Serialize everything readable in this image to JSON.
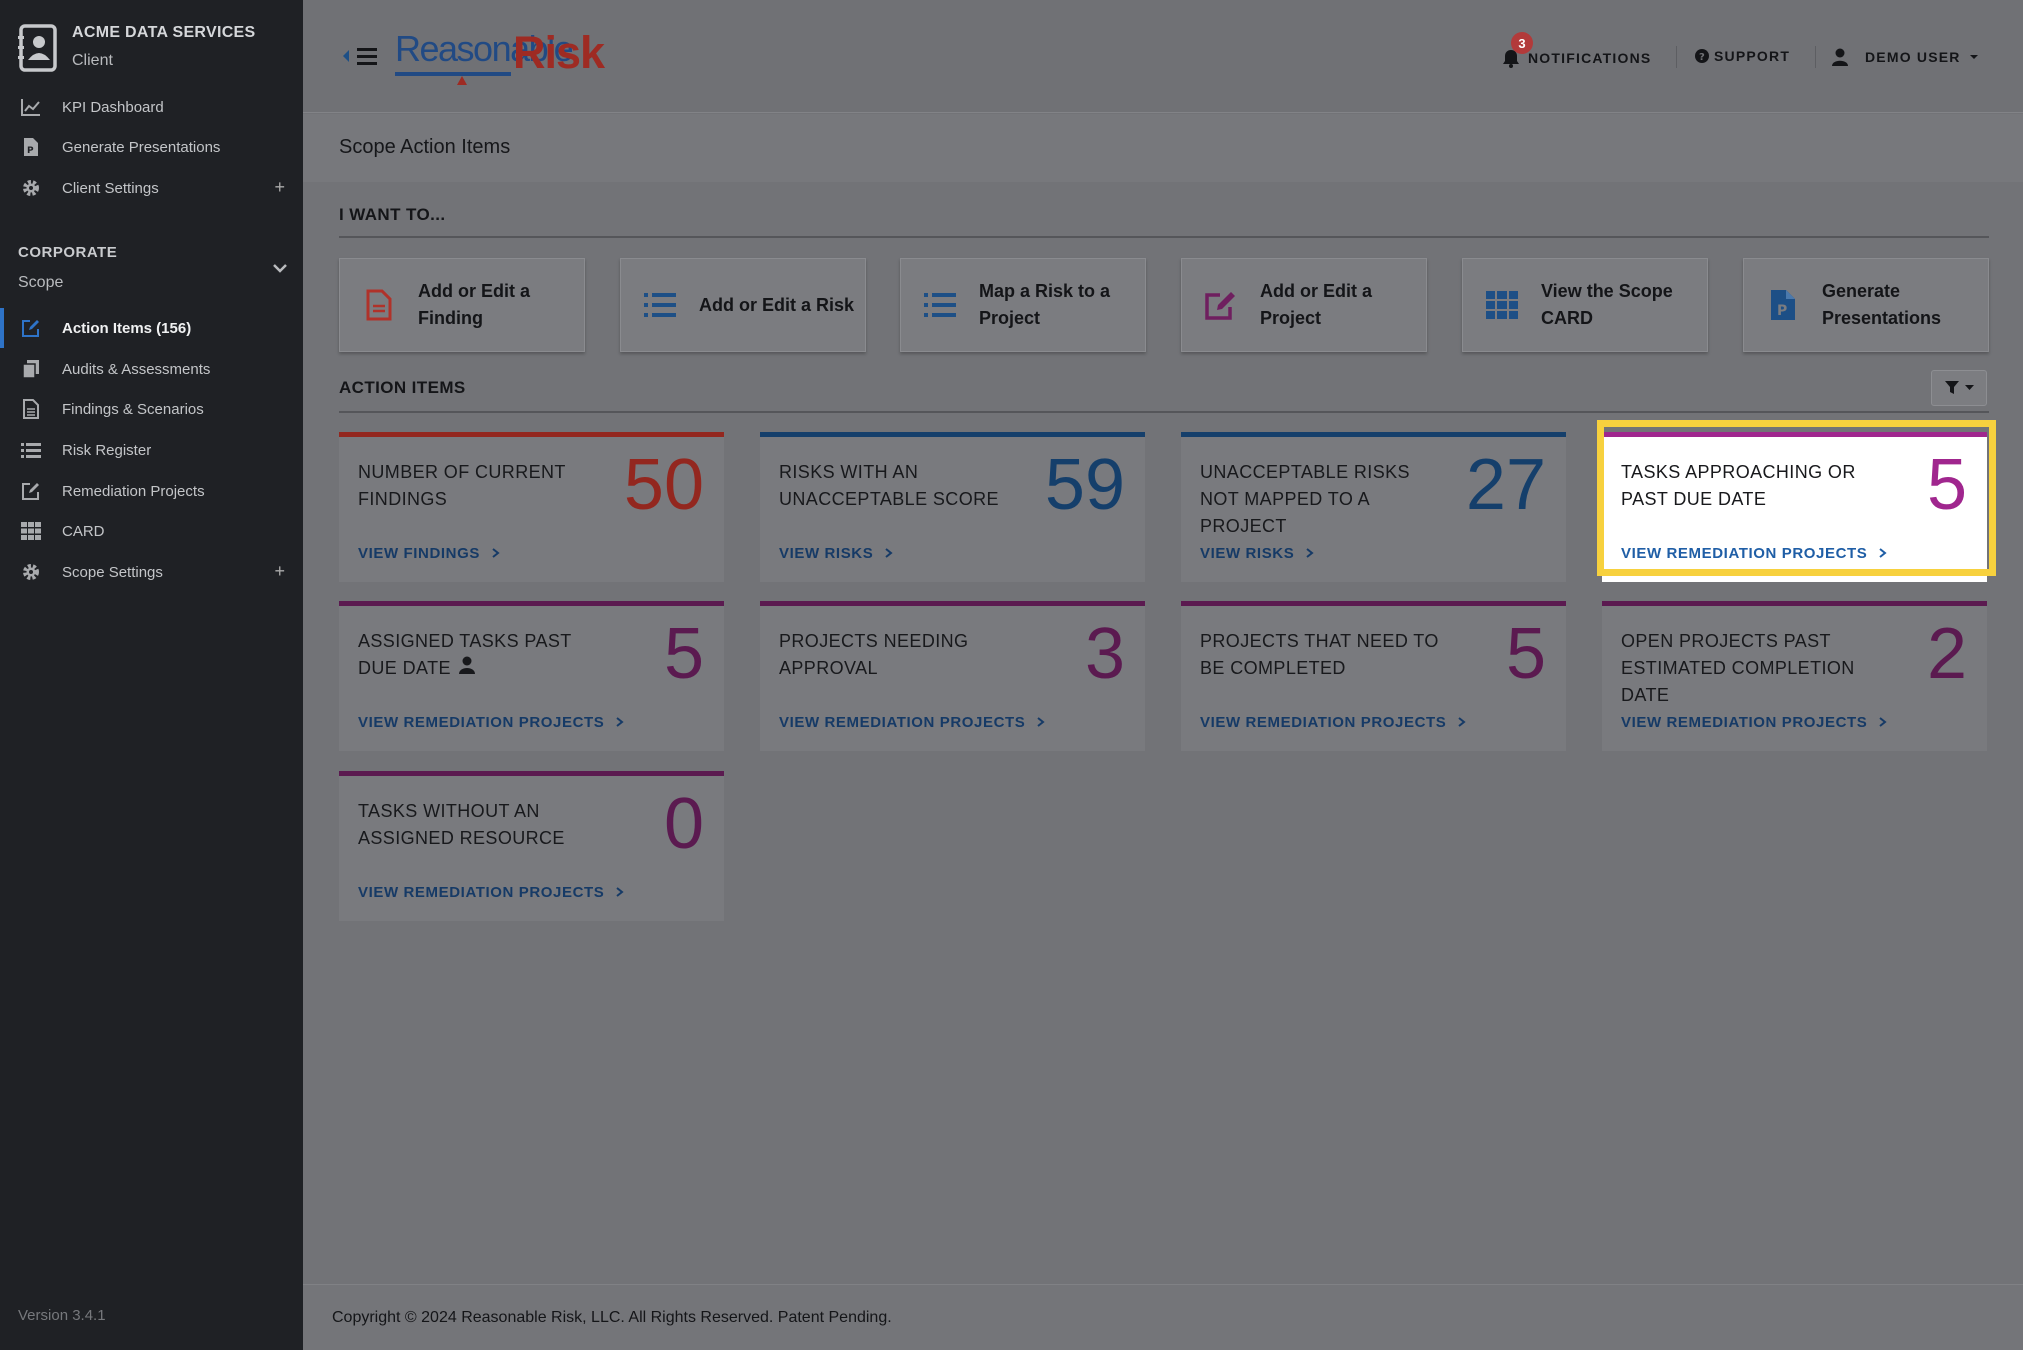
{
  "sidebar": {
    "client_name": "ACME DATA SERVICES",
    "client_type": "Client",
    "top_items": [
      {
        "label": "KPI Dashboard",
        "icon": "chart-line-icon"
      },
      {
        "label": "Generate Presentations",
        "icon": "presentation-file-icon"
      },
      {
        "label": "Client Settings",
        "icon": "gear-icon",
        "expand": "+"
      }
    ],
    "corporate_title": "CORPORATE",
    "corporate_sub": "Scope",
    "scope_items": [
      {
        "label": "Action Items (156)",
        "icon": "edit-square-icon",
        "active": true
      },
      {
        "label": "Audits & Assessments",
        "icon": "copy-docs-icon"
      },
      {
        "label": "Findings & Scenarios",
        "icon": "file-text-icon"
      },
      {
        "label": "Risk Register",
        "icon": "list-icon"
      },
      {
        "label": "Remediation Projects",
        "icon": "edit-square-icon"
      },
      {
        "label": "CARD",
        "icon": "grid-icon"
      },
      {
        "label": "Scope Settings",
        "icon": "gear-icon",
        "expand": "+"
      }
    ],
    "version": "Version 3.4.1"
  },
  "header": {
    "logo_part1": "Reasonable",
    "logo_part2": "Risk",
    "notification_count": "3",
    "notifications_label": "NOTIFICATIONS",
    "support_label": "SUPPORT",
    "user_label": "DEMO USER"
  },
  "page": {
    "title": "Scope Action Items",
    "i_want_to": "I WANT TO...",
    "action_items_title": "ACTION ITEMS"
  },
  "quick_actions": [
    {
      "line1": "Add or Edit a",
      "line2": "Finding",
      "icon": "file-text-icon",
      "color": "#b0322a"
    },
    {
      "line1": "Add or Edit a Risk",
      "line2": "",
      "icon": "list-icon",
      "color": "#1d4f86"
    },
    {
      "line1": "Map a Risk to a",
      "line2": "Project",
      "icon": "list-icon",
      "color": "#1d4f86"
    },
    {
      "line1": "Add or Edit a",
      "line2": "Project",
      "icon": "edit-square-icon",
      "color": "#6f1f5f"
    },
    {
      "line1": "View the Scope",
      "line2": "CARD",
      "icon": "grid-icon",
      "color": "#1d4f86"
    },
    {
      "line1": "Generate",
      "line2": "Presentations",
      "icon": "presentation-file-icon",
      "color": "#1d4f86"
    }
  ],
  "cards": [
    {
      "label": "NUMBER OF CURRENT FINDINGS",
      "value": "50",
      "link": "VIEW FINDINGS",
      "color": "#93271f"
    },
    {
      "label": "RISKS WITH AN UNACCEPTABLE SCORE",
      "value": "59",
      "link": "VIEW RISKS",
      "color": "#153f6b"
    },
    {
      "label": "UNACCEPTABLE RISKS NOT MAPPED TO A PROJECT",
      "value": "27",
      "link": "VIEW RISKS",
      "color": "#153f6b"
    },
    {
      "label": "TASKS APPROACHING OR PAST DUE DATE",
      "value": "5",
      "link": "VIEW REMEDIATION PROJECTS",
      "color": "#a0268e",
      "highlight": true
    },
    {
      "label": "ASSIGNED TASKS PAST DUE DATE",
      "value": "5",
      "link": "VIEW REMEDIATION PROJECTS",
      "color": "#5b1a50",
      "user_icon": true
    },
    {
      "label": "PROJECTS NEEDING APPROVAL",
      "value": "3",
      "link": "VIEW REMEDIATION PROJECTS",
      "color": "#5b1a50"
    },
    {
      "label": "PROJECTS THAT NEED TO BE COMPLETED",
      "value": "5",
      "link": "VIEW REMEDIATION PROJECTS",
      "color": "#5b1a50"
    },
    {
      "label": "OPEN PROJECTS PAST ESTIMATED COMPLETION DATE",
      "value": "2",
      "link": "VIEW REMEDIATION PROJECTS",
      "color": "#5b1a50"
    },
    {
      "label": "TASKS WITHOUT AN ASSIGNED RESOURCE",
      "value": "0",
      "link": "VIEW REMEDIATION PROJECTS",
      "color": "#5b1a50"
    }
  ],
  "footer": {
    "copyright": "Copyright © 2024 Reasonable Risk, LLC. All Rights Reserved. Patent Pending."
  }
}
